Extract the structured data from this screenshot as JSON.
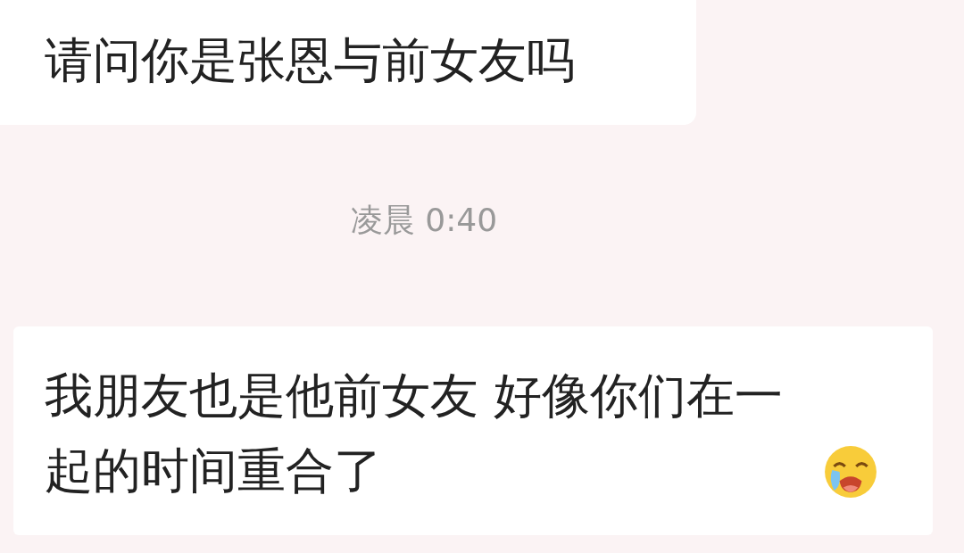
{
  "chat": [
    {
      "kind": "message",
      "text": "请问你是张恩与前女友吗"
    },
    {
      "kind": "time",
      "text": "凌晨 0:40"
    },
    {
      "kind": "message_emoji",
      "text": "我朋友也是他前女友 好像你们在一起的时间重合了"
    }
  ]
}
